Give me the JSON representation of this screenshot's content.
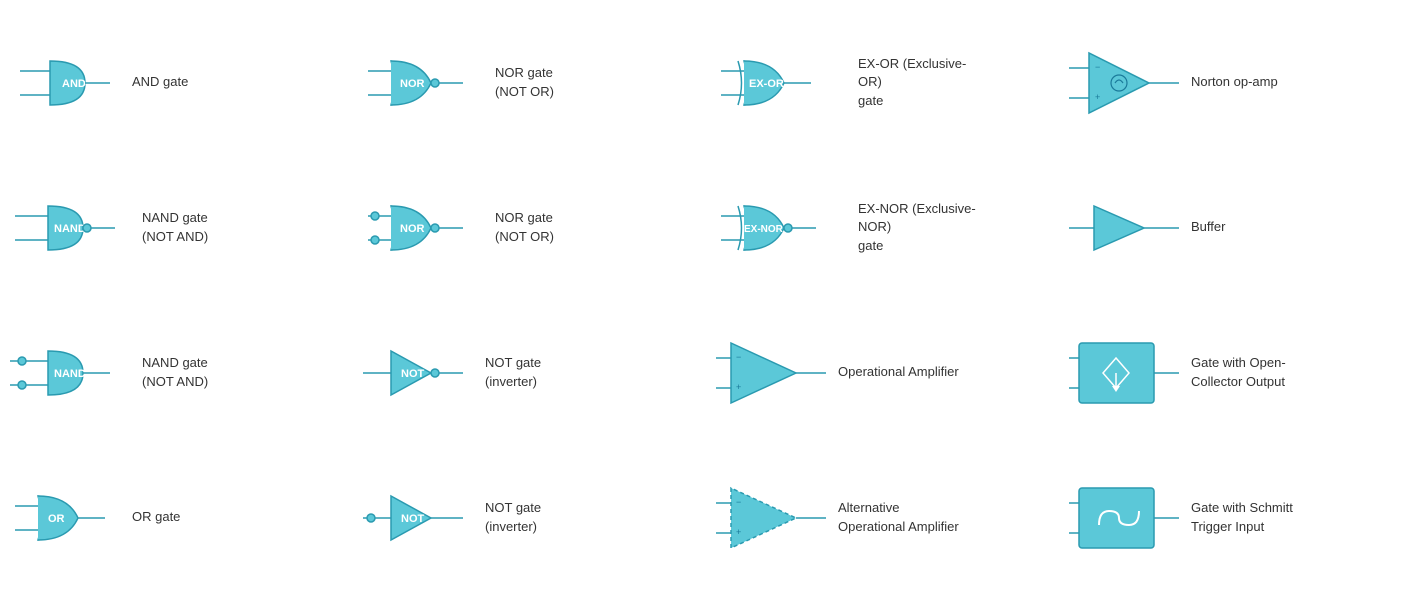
{
  "cells": [
    {
      "id": "and-gate",
      "label": "AND gate"
    },
    {
      "id": "nor-gate-1",
      "label": "NOR gate\n(NOT OR)"
    },
    {
      "id": "ex-or-gate",
      "label": "EX-OR (Exclusive-OR)\ngate"
    },
    {
      "id": "norton-opamp",
      "label": "Norton op-amp"
    },
    {
      "id": "nand-gate-1",
      "label": "NAND gate\n(NOT AND)"
    },
    {
      "id": "nor-gate-2",
      "label": "NOR gate\n(NOT OR)"
    },
    {
      "id": "ex-nor-gate",
      "label": "EX-NOR (Exclusive-NOR)\ngate"
    },
    {
      "id": "buffer",
      "label": "Buffer"
    },
    {
      "id": "nand-gate-2",
      "label": "NAND gate\n(NOT AND)"
    },
    {
      "id": "not-gate-1",
      "label": "NOT gate\n(inverter)"
    },
    {
      "id": "opamp",
      "label": "Operational Amplifier"
    },
    {
      "id": "open-collector",
      "label": "Gate with Open-\nCollector Output"
    },
    {
      "id": "or-gate",
      "label": "OR gate"
    },
    {
      "id": "not-gate-2",
      "label": "NOT gate\n(inverter)"
    },
    {
      "id": "alt-opamp",
      "label": "Alternative\nOperational Amplifier"
    },
    {
      "id": "schmitt",
      "label": "Gate with Schmitt\nTrigger Input"
    }
  ]
}
